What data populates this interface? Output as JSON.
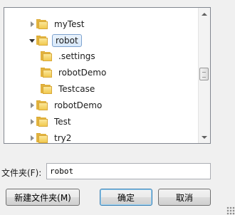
{
  "tree": {
    "items": [
      {
        "label": "myTest",
        "expander": "collapsed",
        "level": 0,
        "selected": false
      },
      {
        "label": "robot",
        "expander": "expanded",
        "level": 0,
        "selected": true
      },
      {
        "label": ".settings",
        "expander": "none",
        "level": 1,
        "selected": false
      },
      {
        "label": "robotDemo",
        "expander": "none",
        "level": 1,
        "selected": false
      },
      {
        "label": "Testcase",
        "expander": "none",
        "level": 1,
        "selected": false
      },
      {
        "label": "robotDemo",
        "expander": "collapsed",
        "level": 0,
        "selected": false
      },
      {
        "label": "Test",
        "expander": "collapsed",
        "level": 0,
        "selected": false
      },
      {
        "label": "try2",
        "expander": "collapsed",
        "level": 0,
        "selected": false
      }
    ]
  },
  "folder_field": {
    "label": "文件夹(F):",
    "value": "robot"
  },
  "buttons": {
    "new_folder": "新建文件夹(M)",
    "ok": "确定",
    "cancel": "取消"
  },
  "colors": {
    "selection_border": "#7da2ce",
    "default_button_border": "#3c7fb1"
  }
}
